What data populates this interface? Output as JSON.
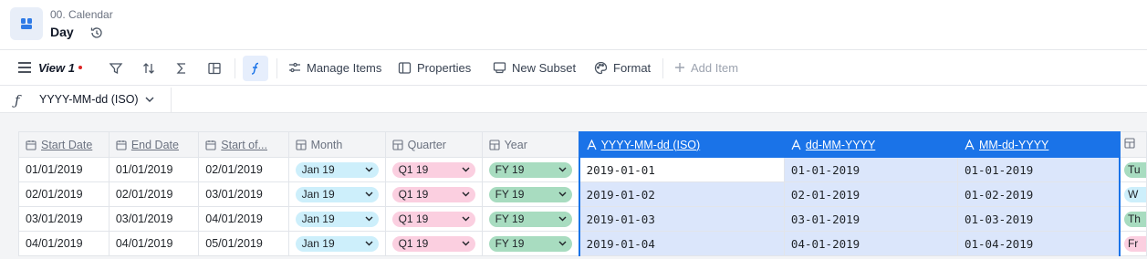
{
  "header": {
    "breadcrumb": "00. Calendar",
    "title": "Day"
  },
  "toolbar": {
    "view_label": "View 1",
    "manage_items": "Manage Items",
    "properties": "Properties",
    "new_subset": "New Subset",
    "format": "Format",
    "add_item": "Add Item"
  },
  "formula_bar": {
    "selected_property": "YYYY-MM-dd (ISO)"
  },
  "colors": {
    "accent": "#1a73e8",
    "month_pill": "#cdeffb",
    "quarter_pill": "#fbcfe0",
    "year_pill": "#a8dcc0",
    "unsaved_dot": "#dc2626"
  },
  "grid": {
    "columns": [
      {
        "label": "Start Date",
        "icon": "calendar-icon"
      },
      {
        "label": "End Date",
        "icon": "calendar-icon"
      },
      {
        "label": "Start of...",
        "icon": "calendar-icon"
      },
      {
        "label": "Month",
        "icon": "list-icon"
      },
      {
        "label": "Quarter",
        "icon": "list-icon"
      },
      {
        "label": "Year",
        "icon": "list-icon"
      },
      {
        "label": "YYYY-MM-dd (ISO)",
        "icon": "text-icon"
      },
      {
        "label": "dd-MM-YYYY",
        "icon": "text-icon"
      },
      {
        "label": "MM-dd-YYYY",
        "icon": "text-icon"
      }
    ],
    "rows": [
      {
        "start": "01/01/2019",
        "end": "01/01/2019",
        "startof": "02/01/2019",
        "month": "Jan 19",
        "quarter": "Q1 19",
        "year": "FY 19",
        "iso": "2019-01-01",
        "dmy": "01-01-2019",
        "mdy": "01-01-2019",
        "edge": "Tu"
      },
      {
        "start": "02/01/2019",
        "end": "02/01/2019",
        "startof": "03/01/2019",
        "month": "Jan 19",
        "quarter": "Q1 19",
        "year": "FY 19",
        "iso": "2019-01-02",
        "dmy": "02-01-2019",
        "mdy": "01-02-2019",
        "edge": "W"
      },
      {
        "start": "03/01/2019",
        "end": "03/01/2019",
        "startof": "04/01/2019",
        "month": "Jan 19",
        "quarter": "Q1 19",
        "year": "FY 19",
        "iso": "2019-01-03",
        "dmy": "03-01-2019",
        "mdy": "01-03-2019",
        "edge": "Th"
      },
      {
        "start": "04/01/2019",
        "end": "04/01/2019",
        "startof": "05/01/2019",
        "month": "Jan 19",
        "quarter": "Q1 19",
        "year": "FY 19",
        "iso": "2019-01-04",
        "dmy": "04-01-2019",
        "mdy": "01-04-2019",
        "edge": "Fr"
      }
    ]
  }
}
